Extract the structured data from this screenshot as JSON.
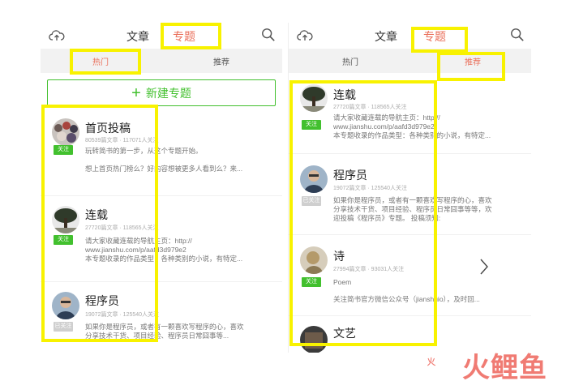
{
  "left": {
    "tabs": [
      "文章",
      "专题"
    ],
    "subtabs": [
      "热门",
      "推荐"
    ],
    "new_topic_label": "新建专题",
    "items": [
      {
        "title": "首页投稿",
        "meta": "80539篇文章 · 117071人关注",
        "follow": "关注",
        "followed": false,
        "desc": [
          "玩转简书的第一步，从这个专题开始。",
          "想上首页热门榜么？好内容想被更多人看到么？来..."
        ],
        "avatar": "crowd-avatar"
      },
      {
        "title": "连载",
        "meta": "27720篇文章 · 118565人关注",
        "follow": "关注",
        "followed": false,
        "desc": [
          "请大家收藏连载的导航主页：http://",
          "www.jianshu.com/p/aafd3d979e2",
          "本专题收录的作品类型：各种类别的小说，有特定..."
        ],
        "avatar": "tree-avatar"
      },
      {
        "title": "程序员",
        "meta": "19072篇文章 · 125540人关注",
        "follow": "已关注",
        "followed": true,
        "desc": [
          "如果你是程序员，或者有一颗喜欢写程序的心，喜欢",
          "分享技术干货、项目经验、程序员日常囧事等..."
        ],
        "avatar": "person-avatar"
      }
    ]
  },
  "right": {
    "tabs": [
      "文章",
      "专题"
    ],
    "subtabs": [
      "热门",
      "推荐"
    ],
    "items": [
      {
        "title": "连载",
        "meta": "27720篇文章 · 118565人关注",
        "follow": "关注",
        "followed": false,
        "desc": [
          "请大家收藏连载的导航主页：http://",
          "www.jianshu.com/p/aafd3d979e2",
          "本专题收录的作品类型：各种类别的小说，有特定..."
        ],
        "avatar": "tree-avatar"
      },
      {
        "title": "程序员",
        "meta": "19072篇文章 · 125540人关注",
        "follow": "已关注",
        "followed": true,
        "desc": [
          "如果你是程序员，或者有一颗喜欢写程序的心，喜欢",
          "分享技术干货、项目经验、程序员日常囧事等等，欢",
          "迎投稿《程序员》专题。 投稿须知:"
        ],
        "avatar": "person-avatar"
      },
      {
        "title": "诗",
        "meta": "27994篇文章 · 93031人关注",
        "follow": "关注",
        "followed": false,
        "desc": [
          "Poem",
          "",
          "关注简书官方微信公众号（jianshuio），及时回..."
        ],
        "avatar": "statue-avatar"
      },
      {
        "title": "文艺",
        "avatar": "book-avatar"
      }
    ]
  },
  "watermark": "火鲤鱼",
  "colors": {
    "accent": "#ea6f5a",
    "green": "#42c02e",
    "highlight": "#f8f200"
  }
}
